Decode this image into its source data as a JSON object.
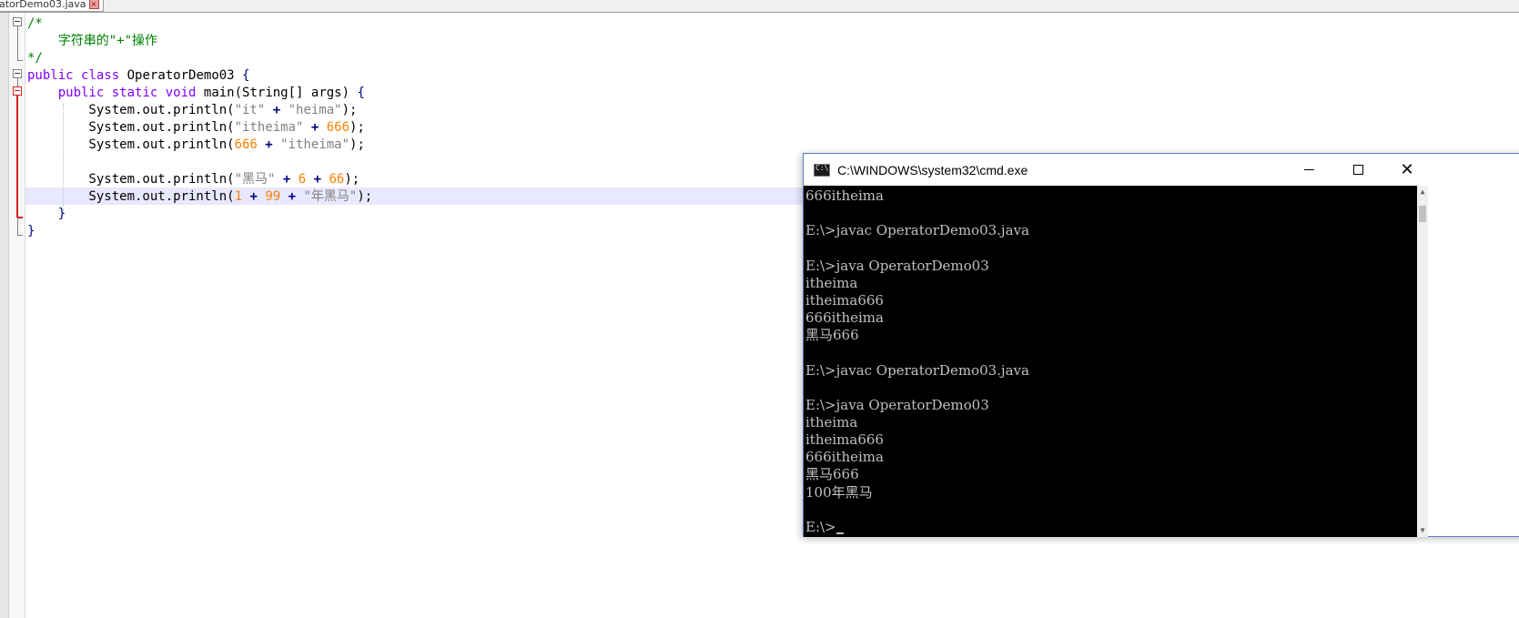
{
  "editor": {
    "tab_label": "atorDemo03.java",
    "lines": [
      {
        "parts": [
          {
            "t": "/*",
            "c": "cm"
          }
        ]
      },
      {
        "parts": [
          {
            "t": "    字符串的\"+\"操作",
            "c": "cm"
          }
        ]
      },
      {
        "parts": [
          {
            "t": "*/",
            "c": "cm"
          }
        ]
      },
      {
        "parts": [
          {
            "t": "public",
            "c": "kw"
          },
          {
            "t": " ",
            "c": ""
          },
          {
            "t": "class",
            "c": "kw"
          },
          {
            "t": " OperatorDemo03 ",
            "c": ""
          },
          {
            "t": "{",
            "c": "br"
          }
        ]
      },
      {
        "parts": [
          {
            "t": "    ",
            "c": ""
          },
          {
            "t": "public",
            "c": "kw"
          },
          {
            "t": " ",
            "c": ""
          },
          {
            "t": "static",
            "c": "kw"
          },
          {
            "t": " ",
            "c": ""
          },
          {
            "t": "void",
            "c": "kw"
          },
          {
            "t": " main(String[] args) ",
            "c": ""
          },
          {
            "t": "{",
            "c": "br"
          }
        ]
      },
      {
        "parts": [
          {
            "t": "        System.out.println(",
            "c": ""
          },
          {
            "t": "\"it\"",
            "c": "str"
          },
          {
            "t": " + ",
            "c": "op"
          },
          {
            "t": "\"heima\"",
            "c": "str"
          },
          {
            "t": ");",
            "c": ""
          }
        ]
      },
      {
        "parts": [
          {
            "t": "        System.out.println(",
            "c": ""
          },
          {
            "t": "\"itheima\"",
            "c": "str"
          },
          {
            "t": " + ",
            "c": "op"
          },
          {
            "t": "666",
            "c": "num"
          },
          {
            "t": ");",
            "c": ""
          }
        ]
      },
      {
        "parts": [
          {
            "t": "        System.out.println(",
            "c": ""
          },
          {
            "t": "666",
            "c": "num"
          },
          {
            "t": " + ",
            "c": "op"
          },
          {
            "t": "\"itheima\"",
            "c": "str"
          },
          {
            "t": ");",
            "c": ""
          }
        ]
      },
      {
        "parts": [
          {
            "t": "",
            "c": ""
          }
        ]
      },
      {
        "parts": [
          {
            "t": "        System.out.println(",
            "c": ""
          },
          {
            "t": "\"黑马\"",
            "c": "str"
          },
          {
            "t": " + ",
            "c": "op"
          },
          {
            "t": "6",
            "c": "num"
          },
          {
            "t": " + ",
            "c": "op"
          },
          {
            "t": "66",
            "c": "num"
          },
          {
            "t": ");",
            "c": ""
          }
        ]
      },
      {
        "parts": [
          {
            "t": "        System.out.println(",
            "c": ""
          },
          {
            "t": "1",
            "c": "num"
          },
          {
            "t": " + ",
            "c": "op"
          },
          {
            "t": "99",
            "c": "num"
          },
          {
            "t": " + ",
            "c": "op"
          },
          {
            "t": "\"年黑马\"",
            "c": "str"
          },
          {
            "t": ");",
            "c": ""
          }
        ]
      },
      {
        "parts": [
          {
            "t": "    ",
            "c": ""
          },
          {
            "t": "}",
            "c": "br"
          }
        ]
      },
      {
        "parts": [
          {
            "t": "}",
            "c": "br"
          }
        ]
      }
    ]
  },
  "cmd": {
    "title": "C:\\WINDOWS\\system32\\cmd.exe",
    "lines": [
      "666itheima",
      "",
      "E:\\>javac OperatorDemo03.java",
      "",
      "E:\\>java OperatorDemo03",
      "itheima",
      "itheima666",
      "666itheima",
      "黑马666",
      "",
      "E:\\>javac OperatorDemo03.java",
      "",
      "E:\\>java OperatorDemo03",
      "itheima",
      "itheima666",
      "666itheima",
      "黑马666",
      "100年黑马",
      "",
      "E:\\>"
    ],
    "minimize_glyph": "",
    "close_glyph": "✕"
  }
}
